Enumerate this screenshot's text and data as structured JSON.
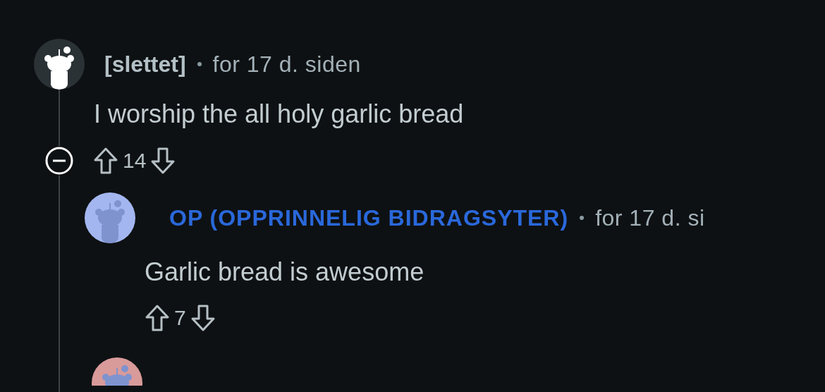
{
  "comments": [
    {
      "author": "[slettet]",
      "is_op": false,
      "time": "for 17 d. siden",
      "body": "I worship the all holy garlic bread",
      "score": "14",
      "color": "#2b3236",
      "collapsible": true,
      "replies": [
        {
          "kind": "comment",
          "author": "OP (OPPRINNELIG BIDRAGSYTER)",
          "is_op": true,
          "time": "for 17 d. si",
          "body": "Garlic bread is awesome",
          "score": "7",
          "color": "#a3b6f0"
        },
        {
          "kind": "cut",
          "color": "#d99a9a"
        }
      ]
    }
  ]
}
